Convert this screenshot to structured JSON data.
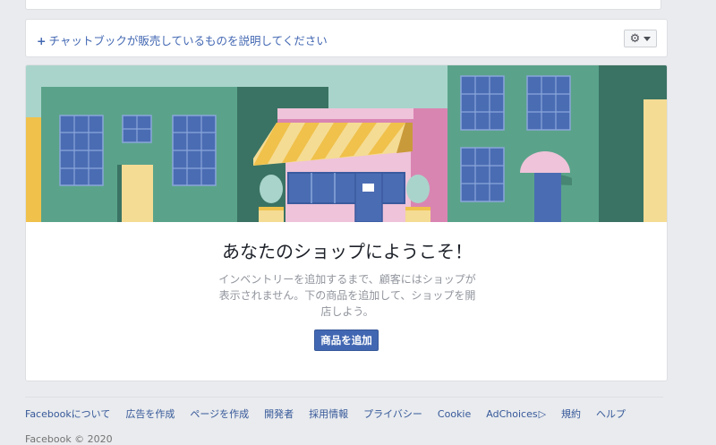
{
  "description_bar": {
    "link_label": "チャットブックが販売しているものを説明してください",
    "plus_glyph": "+",
    "gear_glyph": "⚙"
  },
  "shop_welcome": {
    "title": "あなたのショップにようこそ！",
    "body": "インベントリーを追加するまで、顧客にはショップが表示されません。下の商品を追加して、ショップを開店しよう。",
    "add_product_label": "商品を追加"
  },
  "illustration": {
    "sky": "#a9d4cb",
    "building_green": "#5aa38a",
    "building_dark": "#3a7363",
    "window_blue": "#4a6cb3",
    "shop_pink": "#efc3d9",
    "awning_yellow": "#f0c14b",
    "door_yellow": "#f5dc94"
  },
  "footer": {
    "links": [
      {
        "label": "Facebookについて"
      },
      {
        "label": "広告を作成"
      },
      {
        "label": "ページを作成"
      },
      {
        "label": "開発者"
      },
      {
        "label": "採用情報"
      },
      {
        "label": "プライバシー"
      },
      {
        "label": "Cookie"
      },
      {
        "label": "AdChoices"
      },
      {
        "label": "規約"
      },
      {
        "label": "ヘルプ"
      }
    ],
    "adchoices_icon": "▷",
    "copyright": "Facebook © 2020"
  }
}
